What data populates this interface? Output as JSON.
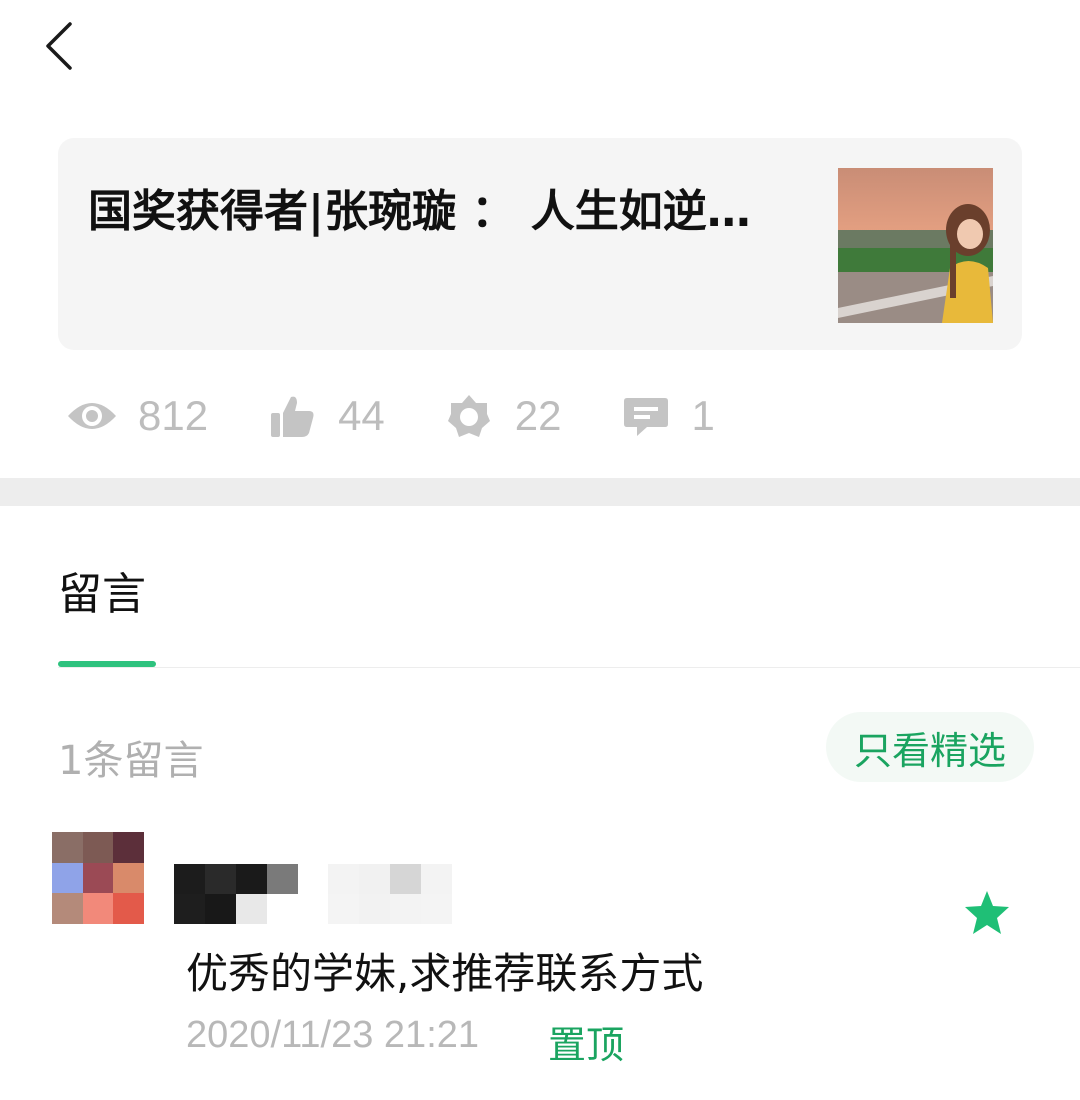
{
  "article": {
    "title": "国奖获得者|张琬璇 ： 人生如逆…"
  },
  "stats": {
    "views": "812",
    "likes": "44",
    "wow": "22",
    "comments": "1"
  },
  "tabs": {
    "comments_label": "留言"
  },
  "comments_header": {
    "count_text": "1条留言",
    "featured_only_label": "只看精选"
  },
  "comment": {
    "text": "优秀的学妹,求推荐联系方式",
    "time": "2020/11/23 21:21",
    "pin_label": "置顶"
  },
  "colors": {
    "accent": "#2ec27e",
    "accent_text": "#1aa460",
    "muted": "#bdbdbd"
  }
}
